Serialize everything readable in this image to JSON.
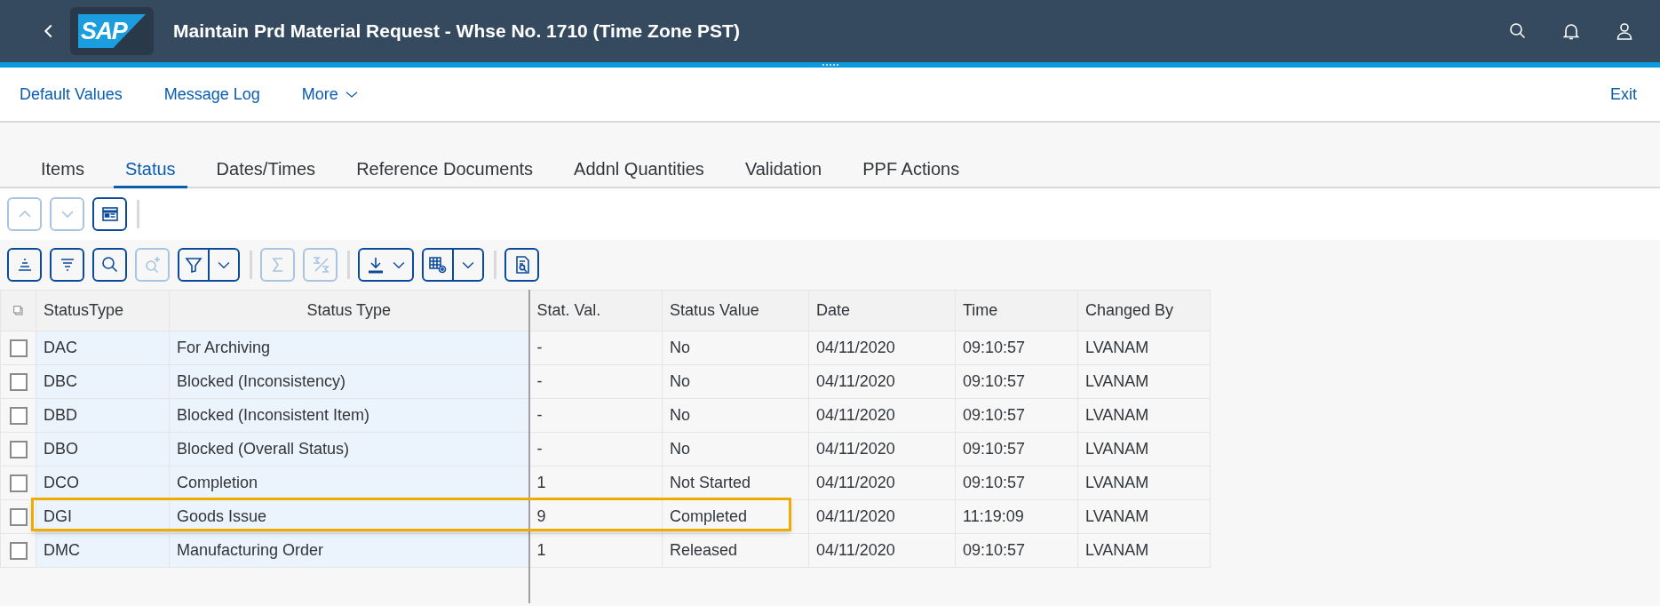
{
  "header": {
    "title": "Maintain Prd Material Request - Whse No. 1710 (Time Zone PST)",
    "logo": "SAP"
  },
  "menu": {
    "items": [
      {
        "label": "Default Values",
        "kind": "link"
      },
      {
        "label": "Message Log",
        "kind": "link"
      },
      {
        "label": "More",
        "kind": "dropdown"
      }
    ],
    "exit": "Exit"
  },
  "tabs": [
    {
      "label": "Items",
      "selected": false
    },
    {
      "label": "Status",
      "selected": true
    },
    {
      "label": "Dates/Times",
      "selected": false
    },
    {
      "label": "Reference Documents",
      "selected": false
    },
    {
      "label": "Addnl Quantities",
      "selected": false
    },
    {
      "label": "Validation",
      "selected": false
    },
    {
      "label": "PPF Actions",
      "selected": false
    }
  ],
  "nav_toolbar": [
    {
      "kind": "up",
      "disabled": true
    },
    {
      "kind": "down",
      "disabled": true
    },
    {
      "kind": "layout",
      "disabled": false
    }
  ],
  "table_toolbar": [
    {
      "kind": "sort-asc",
      "disabled": false
    },
    {
      "kind": "sort-desc",
      "disabled": false
    },
    {
      "kind": "find",
      "disabled": false
    },
    {
      "kind": "find-next",
      "disabled": true
    },
    {
      "kind": "filter",
      "disabled": false
    },
    {
      "kind": "sum",
      "disabled": true
    },
    {
      "kind": "subtotal",
      "disabled": true
    },
    {
      "kind": "export",
      "disabled": false
    },
    {
      "kind": "settings",
      "disabled": false
    },
    {
      "kind": "details",
      "disabled": false
    }
  ],
  "table": {
    "columns": [
      "StatusType",
      "Status Type",
      "Stat. Val.",
      "Status Value",
      "Date",
      "Time",
      "Changed By"
    ],
    "rows": [
      {
        "cells": [
          "DAC",
          "For Archiving",
          "-",
          "No",
          "04/11/2020",
          "09:10:57",
          "LVANAM"
        ],
        "checked": false,
        "highlighted": false
      },
      {
        "cells": [
          "DBC",
          "Blocked (Inconsistency)",
          "-",
          "No",
          "04/11/2020",
          "09:10:57",
          "LVANAM"
        ],
        "checked": false,
        "highlighted": false
      },
      {
        "cells": [
          "DBD",
          "Blocked (Inconsistent Item)",
          "-",
          "No",
          "04/11/2020",
          "09:10:57",
          "LVANAM"
        ],
        "checked": false,
        "highlighted": false
      },
      {
        "cells": [
          "DBO",
          "Blocked (Overall Status)",
          "-",
          "No",
          "04/11/2020",
          "09:10:57",
          "LVANAM"
        ],
        "checked": false,
        "highlighted": false
      },
      {
        "cells": [
          "DCO",
          "Completion",
          "1",
          "Not Started",
          "04/11/2020",
          "09:10:57",
          "LVANAM"
        ],
        "checked": false,
        "highlighted": false
      },
      {
        "cells": [
          "DGI",
          "Goods Issue",
          "9",
          "Completed",
          "04/11/2020",
          "11:19:09",
          "LVANAM"
        ],
        "checked": false,
        "highlighted": true
      },
      {
        "cells": [
          "DMC",
          "Manufacturing Order",
          "1",
          "Released",
          "04/11/2020",
          "09:10:57",
          "LVANAM"
        ],
        "checked": false,
        "highlighted": false
      }
    ]
  }
}
